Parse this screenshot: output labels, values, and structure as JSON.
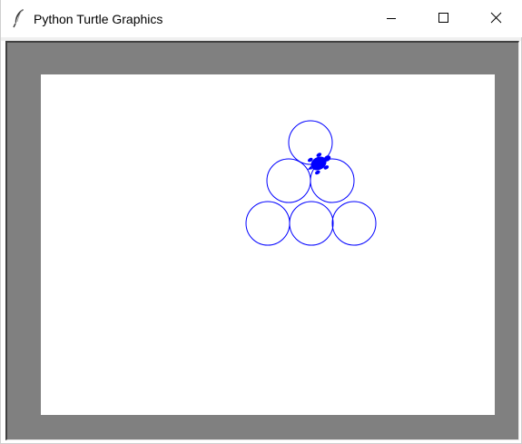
{
  "window": {
    "title": "Python Turtle Graphics",
    "icon": "feather-icon",
    "controls": {
      "minimize": "minimize-icon",
      "maximize": "maximize-icon",
      "close": "close-icon"
    }
  },
  "canvas": {
    "background": "#ffffff",
    "frame_color": "#808080",
    "pen_color": "#0000ff",
    "circles": [
      {
        "row": 1,
        "position": 1
      },
      {
        "row": 2,
        "position": 1
      },
      {
        "row": 2,
        "position": 2
      },
      {
        "row": 3,
        "position": 1
      },
      {
        "row": 3,
        "position": 2
      },
      {
        "row": 3,
        "position": 3
      }
    ],
    "turtle": {
      "shape": "turtle-icon",
      "color": "#0000ff"
    }
  }
}
